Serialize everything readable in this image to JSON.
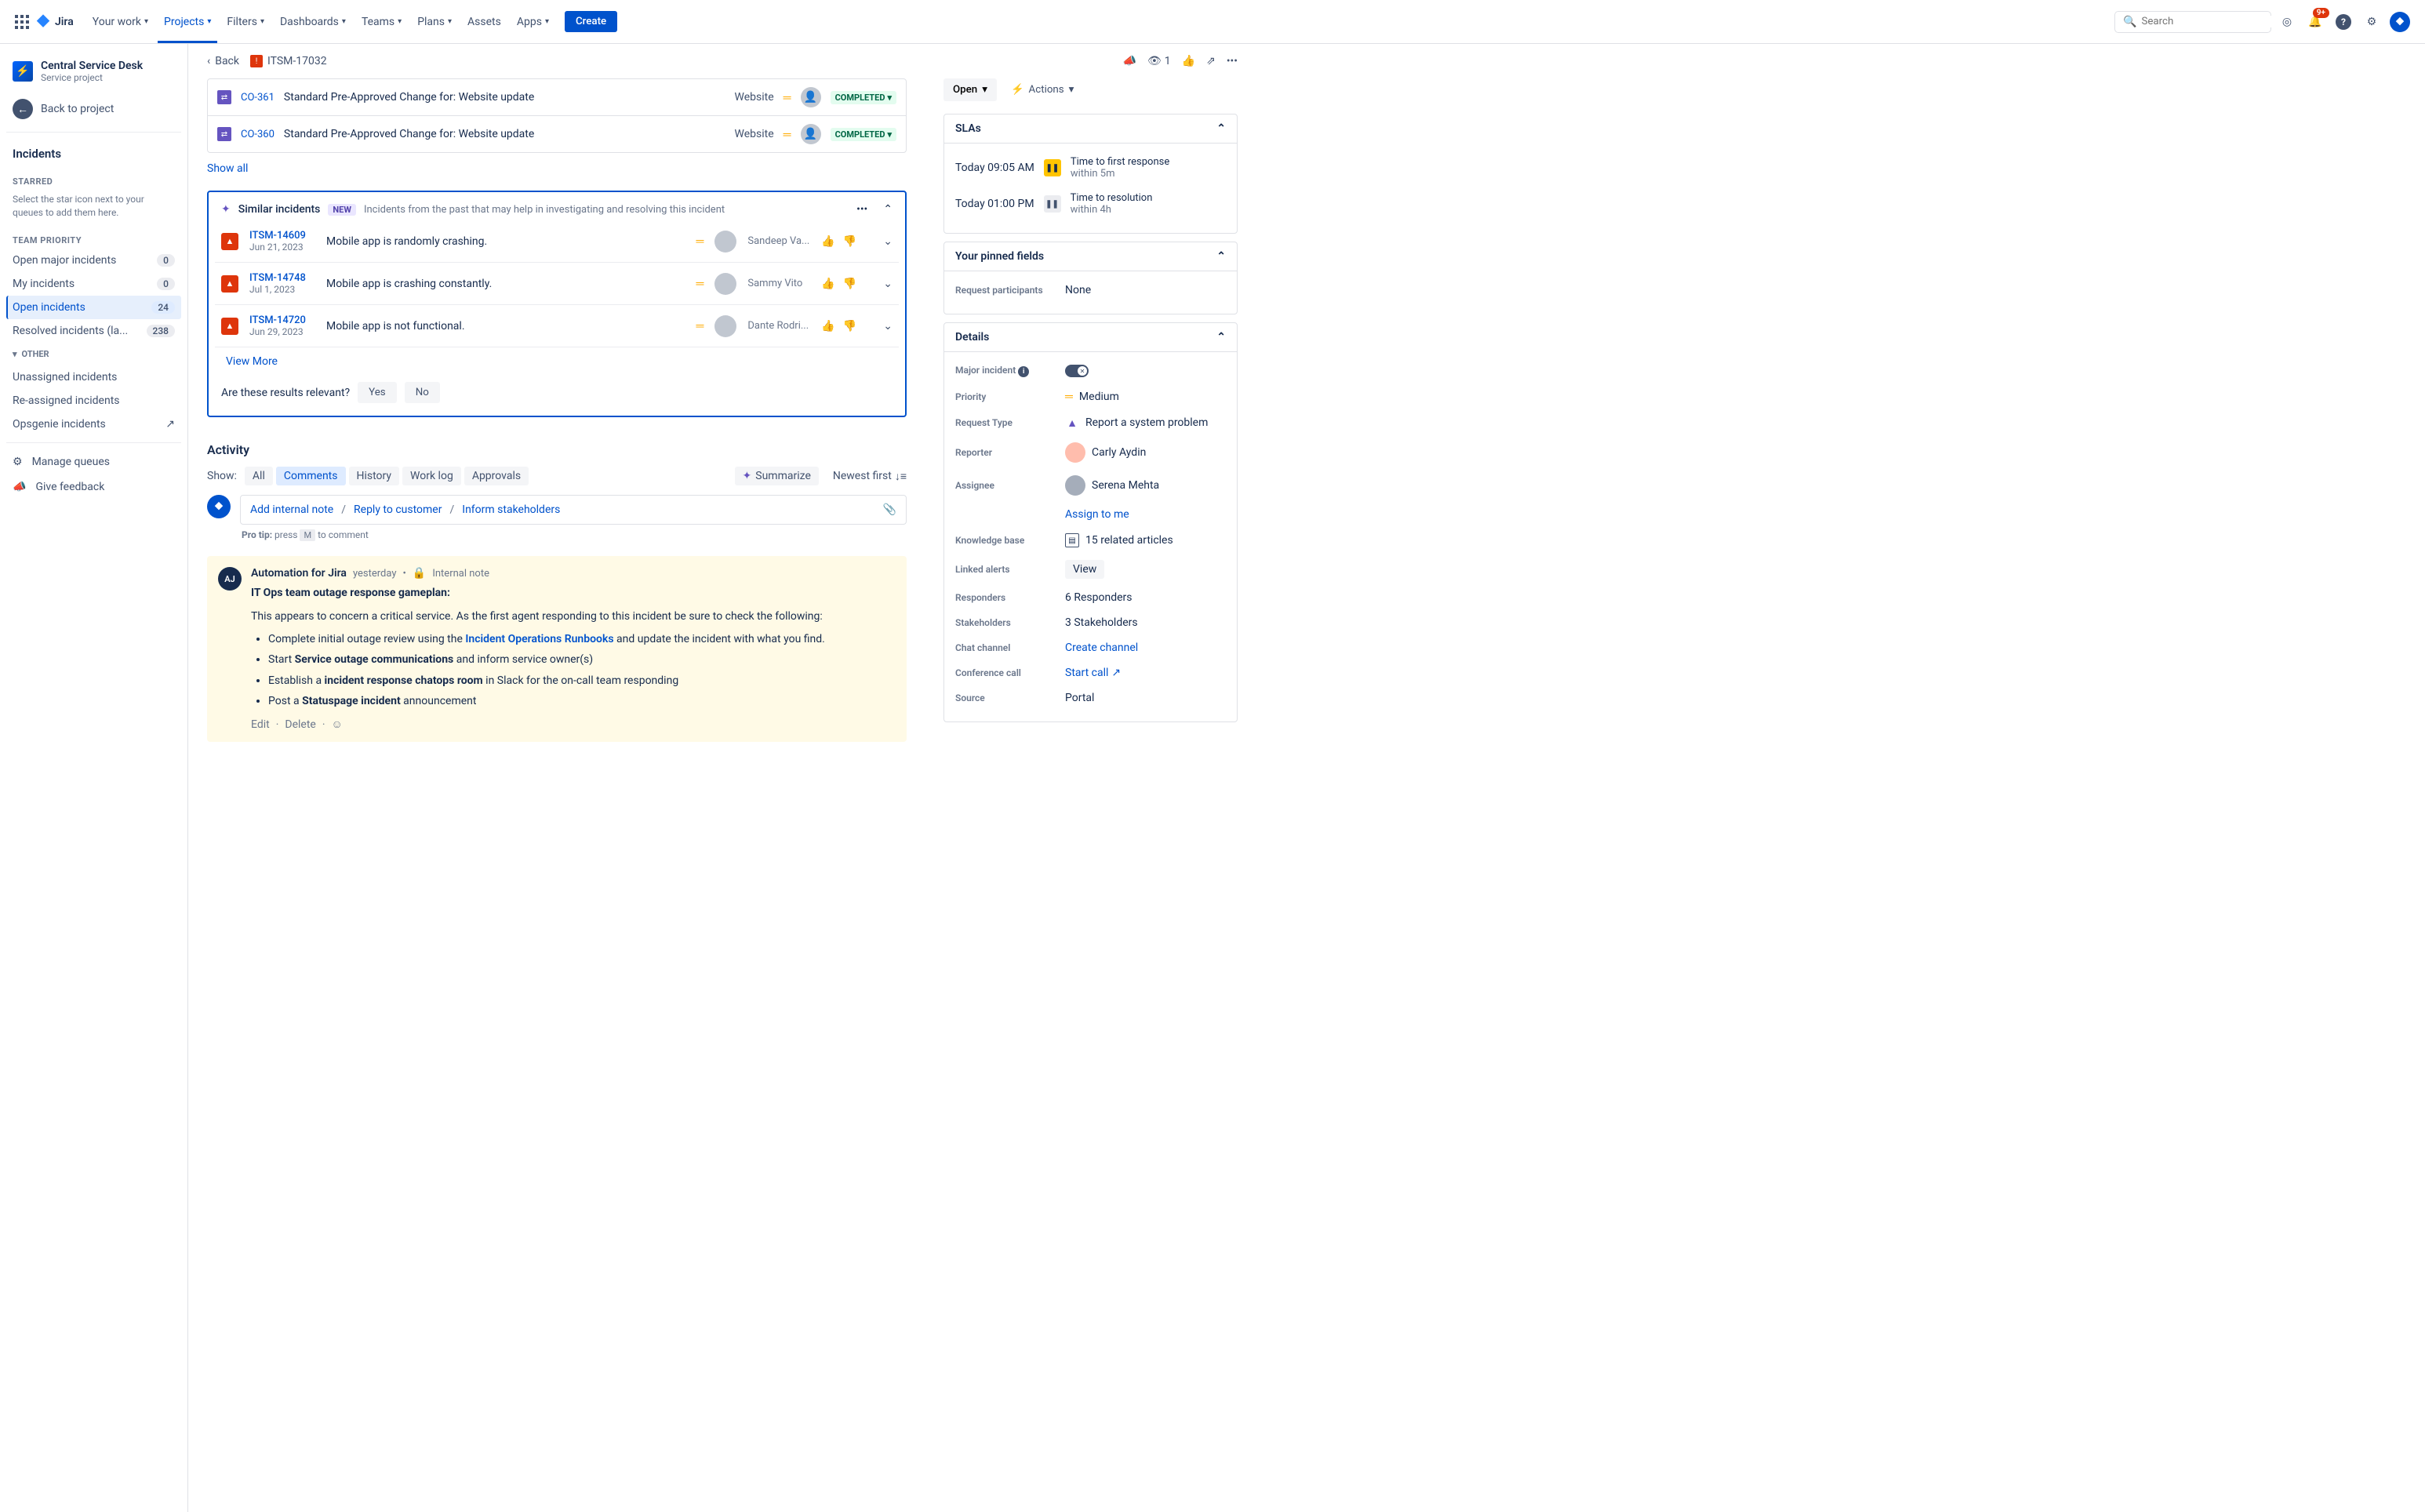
{
  "nav": {
    "brand": "Jira",
    "items": [
      "Your work",
      "Projects",
      "Filters",
      "Dashboards",
      "Teams",
      "Plans",
      "Assets",
      "Apps"
    ],
    "create": "Create",
    "search_placeholder": "Search",
    "notification_badge": "9+"
  },
  "sidebar": {
    "project_name": "Central Service Desk",
    "project_type": "Service project",
    "back": "Back to project",
    "heading": "Incidents",
    "starred_label": "STARRED",
    "starred_hint": "Select the star icon next to your queues to add them here.",
    "priority_label": "TEAM PRIORITY",
    "queues": [
      {
        "name": "Open major incidents",
        "count": "0"
      },
      {
        "name": "My incidents",
        "count": "0"
      },
      {
        "name": "Open incidents",
        "count": "24",
        "selected": true
      },
      {
        "name": "Resolved incidents (la...",
        "count": "238"
      }
    ],
    "other_label": "OTHER",
    "other_items": [
      "Unassigned incidents",
      "Re-assigned incidents",
      "Opsgenie incidents"
    ],
    "manage_queues": "Manage queues",
    "feedback": "Give feedback"
  },
  "breadcrumb": {
    "back": "Back",
    "issue_key": "ITSM-17032"
  },
  "linked": [
    {
      "key": "CO-361",
      "title": "Standard Pre-Approved Change for: Website update",
      "category": "Website",
      "status": "COMPLETED"
    },
    {
      "key": "CO-360",
      "title": "Standard Pre-Approved Change for: Website update",
      "category": "Website",
      "status": "COMPLETED"
    }
  ],
  "show_all": "Show all",
  "similar": {
    "title": "Similar incidents",
    "new_label": "NEW",
    "hint": "Incidents from the past that may help in investigating and resolving this incident",
    "items": [
      {
        "key": "ITSM-14609",
        "date": "Jun 21, 2023",
        "title": "Mobile app is randomly crashing.",
        "assignee": "Sandeep Va..."
      },
      {
        "key": "ITSM-14748",
        "date": "Jul 1, 2023",
        "title": "Mobile app is crashing constantly.",
        "assignee": "Sammy Vito"
      },
      {
        "key": "ITSM-14720",
        "date": "Jun 29, 2023",
        "title": "Mobile app is not functional.",
        "assignee": "Dante Rodri..."
      }
    ],
    "view_more": "View More",
    "relevance_q": "Are these results relevant?",
    "yes": "Yes",
    "no": "No"
  },
  "activity": {
    "heading": "Activity",
    "show": "Show:",
    "tabs": [
      "All",
      "Comments",
      "History",
      "Work log",
      "Approvals"
    ],
    "summarize": "Summarize",
    "newest": "Newest first",
    "add_note": "Add internal note",
    "reply": "Reply to customer",
    "inform": "Inform stakeholders",
    "protip_pre": "Pro tip:",
    "protip_press": " press ",
    "protip_key": "M",
    "protip_post": " to comment"
  },
  "comment": {
    "avatar_text": "AJ",
    "author": "Automation for Jira",
    "time": "yesterday",
    "internal": "Internal note",
    "title": "IT Ops team outage response gameplan:",
    "intro": "This appears to concern a critical service. As the first agent responding to this incident be sure to check the following:",
    "bullet1_pre": "Complete initial outage review using the ",
    "bullet1_link": "Incident Operations Runbooks",
    "bullet1_post": " and update the incident with what you find.",
    "bullet2_pre": "Start ",
    "bullet2_bold": "Service outage communications",
    "bullet2_post": " and inform service owner(s)",
    "bullet3_pre": "Establish a ",
    "bullet3_bold": "incident response chatops room",
    "bullet3_post": " in Slack for the on-call team responding",
    "bullet4_pre": "Post a ",
    "bullet4_bold": "Statuspage incident",
    "bullet4_post": " announcement",
    "edit": "Edit",
    "delete": "Delete"
  },
  "right": {
    "watch_count": "1",
    "status": "Open",
    "actions": "Actions",
    "slas": {
      "title": "SLAs",
      "items": [
        {
          "time": "Today 09:05 AM",
          "label": "Time to first response",
          "within": "within 5m",
          "warn": true
        },
        {
          "time": "Today 01:00 PM",
          "label": "Time to resolution",
          "within": "within 4h",
          "warn": false
        }
      ]
    },
    "pinned": {
      "title": "Your pinned fields",
      "participants_label": "Request participants",
      "participants_value": "None"
    },
    "details": {
      "title": "Details",
      "major_label": "Major incident",
      "priority_label": "Priority",
      "priority_value": "Medium",
      "request_type_label": "Request Type",
      "request_type_value": "Report a system problem",
      "reporter_label": "Reporter",
      "reporter_value": "Carly Aydin",
      "assignee_label": "Assignee",
      "assignee_value": "Serena Mehta",
      "assign_to_me": "Assign to me",
      "kb_label": "Knowledge base",
      "kb_value": "15 related articles",
      "alerts_label": "Linked alerts",
      "alerts_value": "View",
      "responders_label": "Responders",
      "responders_value": "6 Responders",
      "stakeholders_label": "Stakeholders",
      "stakeholders_value": "3 Stakeholders",
      "chat_label": "Chat channel",
      "chat_value": "Create channel",
      "conf_label": "Conference call",
      "conf_value": "Start call",
      "source_label": "Source",
      "source_value": "Portal"
    }
  }
}
